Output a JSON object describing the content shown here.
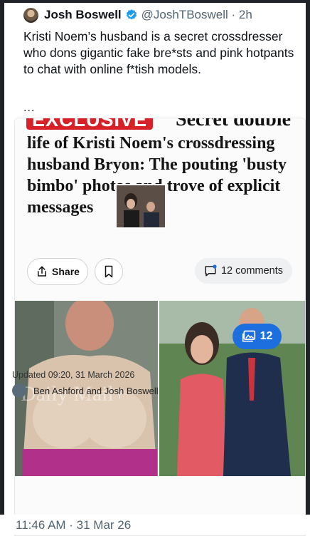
{
  "post": {
    "author": "Josh Boswell",
    "handle": "@JoshTBoswell · 2h",
    "text": "Kristi Noem’s husband is a secret crossdresser who dons gigantic fake bre*sts and pink hotpants to chat with online f*tish models.",
    "more": "...",
    "timestamp": "11:46 AM · 31 Mar 26"
  },
  "card": {
    "badge": "EXCLUSIVE",
    "headline_cut": "Secret double",
    "headline": "life of Kristi Noem's crossdressing husband Bryon: The pouting 'busty bimbo' photos and trove of explicit messages",
    "share_label": "Share",
    "comments_label": "12 comments",
    "photo_count": "12",
    "watermark": "Daily Mail+",
    "inset_caption": "",
    "updated": "Updated 09:20, 31 March 2026",
    "byline": "Ben Ashford and Josh Boswell"
  },
  "colors": {
    "accent_blue": "#1d9bf0",
    "badge_red": "#d62128",
    "photo_count_bg": "#1d6fe0"
  },
  "icons": [
    "verified-badge-icon",
    "share-icon",
    "bookmark-icon",
    "comment-icon",
    "gallery-icon"
  ]
}
